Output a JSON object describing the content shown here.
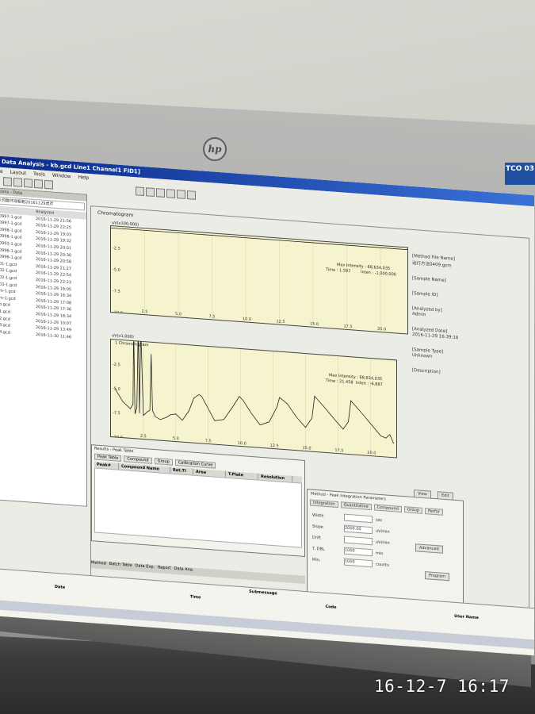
{
  "photo": {
    "timestamp": "16-12-7  16:17",
    "monitor_logo": "hp",
    "badge": "TCO 03"
  },
  "window": {
    "title": "Data Analysis - kb.gcd Line1 Channel1 FID1]",
    "menu": [
      "e",
      "Layout",
      "Tools",
      "Window",
      "Help"
    ]
  },
  "left_panel": {
    "header": "rations - Data",
    "path": "八何散环戒粗粗20161129虎芹",
    "col_analyzed": "Analyzed",
    "files": [
      {
        "name": "0997-1.gcd",
        "date": "2016-11-29 21:56"
      },
      {
        "name": "0997-1.gcd",
        "date": "2016-11-29 22:25"
      },
      {
        "name": "0998-1.gcd",
        "date": "2016-11-29 19:03"
      },
      {
        "name": "0998-1.gcd",
        "date": "2016-11-29 19:32"
      },
      {
        "name": "0993-1.gcd",
        "date": "2016-11-29 20:01"
      },
      {
        "name": "0996-1.gcd",
        "date": "2016-11-29 20:30"
      },
      {
        "name": "0996-1.gcd",
        "date": "2016-11-29 20:58"
      },
      {
        "name": "01-1.gcd",
        "date": "2016-11-29 21:27"
      },
      {
        "name": "02-1.gcd",
        "date": "2016-11-29 22:54"
      },
      {
        "name": "02-1.gcd",
        "date": "2016-11-29 22:23"
      },
      {
        "name": "03-1.gcd",
        "date": "2016-11-29 16:05"
      },
      {
        "name": "m-1.gcd",
        "date": "2016-11-29 16:34"
      },
      {
        "name": "m-1.gcd",
        "date": "2016-11-29 17:08"
      },
      {
        "name": "b.gcd",
        "date": "2016-11-29 17:36"
      },
      {
        "name": "1.gcd",
        "date": "2016-11-29 18:34"
      },
      {
        "name": "2.gcd",
        "date": "2016-11-29 10:07"
      },
      {
        "name": "3.gcd",
        "date": "2016-11-29 13:49"
      },
      {
        "name": "4.gcd",
        "date": "2016-11-30 11:46"
      }
    ]
  },
  "chromatogram": {
    "label": "Chromatogram",
    "plot1": {
      "scale_label": "uV(x100,000)",
      "max_intensity": "Max Intensity : 68,634,035",
      "time": "Time : 1.597",
      "inten": "Inten : -1,000,000",
      "yticks": [
        "-2.5",
        "-5.0",
        "-7.5",
        "-10.0"
      ],
      "xticks": [
        "2.5",
        "5.0",
        "7.5",
        "10.0",
        "12.5",
        "15.0",
        "17.5",
        "20.0"
      ],
      "xunit": "min"
    },
    "plot2": {
      "scale_label": "uV(x1,000)",
      "series_label": "1 Chromatogram",
      "max_intensity": "Max Intensity : 68,634,035",
      "time": "Time : 21.458",
      "inten": "Inten : -6,887",
      "yticks": [
        "-2.5",
        "-5.0",
        "-7.5",
        "-10.0"
      ],
      "xticks": [
        "2.5",
        "5.0",
        "7.5",
        "10.0",
        "12.5",
        "15.0",
        "17.5",
        "20.0"
      ],
      "xunit": "min"
    },
    "side_info": [
      "[Method File Name]",
      "运行方法0409.gcm",
      "[Sample Name]",
      "[Sample ID]",
      "[Analyzed by]",
      "Admin",
      "[Analyzed Date]",
      "2016-11-29 16:39:16",
      "[Sample Type]",
      "Unknown",
      "[Description]"
    ]
  },
  "results": {
    "title": "Results - Peak Table",
    "tabs": [
      "Peak Table",
      "Compound",
      "Group",
      "Calibration Curve"
    ],
    "columns": [
      "Peak#",
      "Compound Name",
      "Ret.Ti",
      "Area",
      "T.Plate",
      "Resolution"
    ]
  },
  "method": {
    "title": "Method - Peak Integration Parameters",
    "tabs": [
      "Integration",
      "Quantitative",
      "Compound",
      "Group",
      "Perfor"
    ],
    "rows": [
      {
        "label": "Width",
        "value": "",
        "unit": "sec"
      },
      {
        "label": "Slope",
        "value": "2000.00",
        "unit": "uV/min"
      },
      {
        "label": "Drift",
        "value": "",
        "unit": "uV/min"
      },
      {
        "label": "T. DBL",
        "value": "1000",
        "unit": "min"
      },
      {
        "label": "Min.",
        "value": "1000",
        "unit": "counts"
      }
    ],
    "advanced_label": "Advanced",
    "view_label": "View",
    "edit_label": "Edit",
    "program_label": "Program"
  },
  "bottom": {
    "subtitle": "Submessage",
    "columns": [
      "Date",
      "Time",
      "Code",
      "User Name"
    ],
    "buttons": [
      "Method",
      "Batch Table",
      "Data Exp.",
      "Report",
      "Data Ana."
    ]
  },
  "chart_data": [
    {
      "type": "line",
      "title": "",
      "xlabel": "min",
      "ylabel": "uV(x100,000)",
      "xlim": [
        0,
        22
      ],
      "ylim": [
        -10.0,
        0
      ],
      "series": [
        {
          "x": [
            0,
            22
          ],
          "values": [
            -0.2,
            -0.2
          ]
        }
      ]
    },
    {
      "type": "line",
      "title": "",
      "xlabel": "min",
      "ylabel": "uV(x1,000)",
      "xlim": [
        0,
        22
      ],
      "ylim": [
        -10.0,
        0
      ],
      "series": [
        {
          "name": "1 Chromatogram",
          "x": [
            0.3,
            0.9,
            1.5,
            1.7,
            1.75,
            1.85,
            2.0,
            2.1,
            2.2,
            2.3,
            2.5,
            2.8,
            3.0,
            3.1,
            3.2,
            3.4,
            3.8,
            4.3,
            4.6,
            5.0,
            5.5,
            6.0,
            6.4,
            6.8,
            7.0,
            7.5,
            8.0,
            8.7,
            9.4,
            9.9,
            10.2,
            10.8,
            11.5,
            12.2,
            12.8,
            13.0,
            13.6,
            14.3,
            15.0,
            15.5,
            15.7,
            16.4,
            17.2,
            17.9,
            18.3,
            18.5,
            19.2,
            20.0,
            20.8,
            21.2,
            21.5,
            21.8
          ],
          "values": [
            -5.0,
            -6.3,
            -7.0,
            -6.5,
            1.5,
            -7.5,
            -6.8,
            1.5,
            -7.4,
            1.5,
            -7.6,
            -7.2,
            -7.0,
            -1.2,
            -7.0,
            -7.6,
            -7.9,
            -7.6,
            -7.3,
            -7.2,
            -7.8,
            -6.8,
            -5.4,
            -5.0,
            -5.2,
            -6.4,
            -7.6,
            -7.4,
            -6.0,
            -4.9,
            -5.3,
            -6.5,
            -7.7,
            -7.3,
            -5.7,
            -4.7,
            -5.3,
            -6.6,
            -7.6,
            -6.6,
            -4.3,
            -5.3,
            -6.5,
            -7.5,
            -6.7,
            -4.5,
            -5.5,
            -6.7,
            -7.9,
            -8.1,
            -7.7,
            -8.6
          ]
        }
      ]
    }
  ]
}
